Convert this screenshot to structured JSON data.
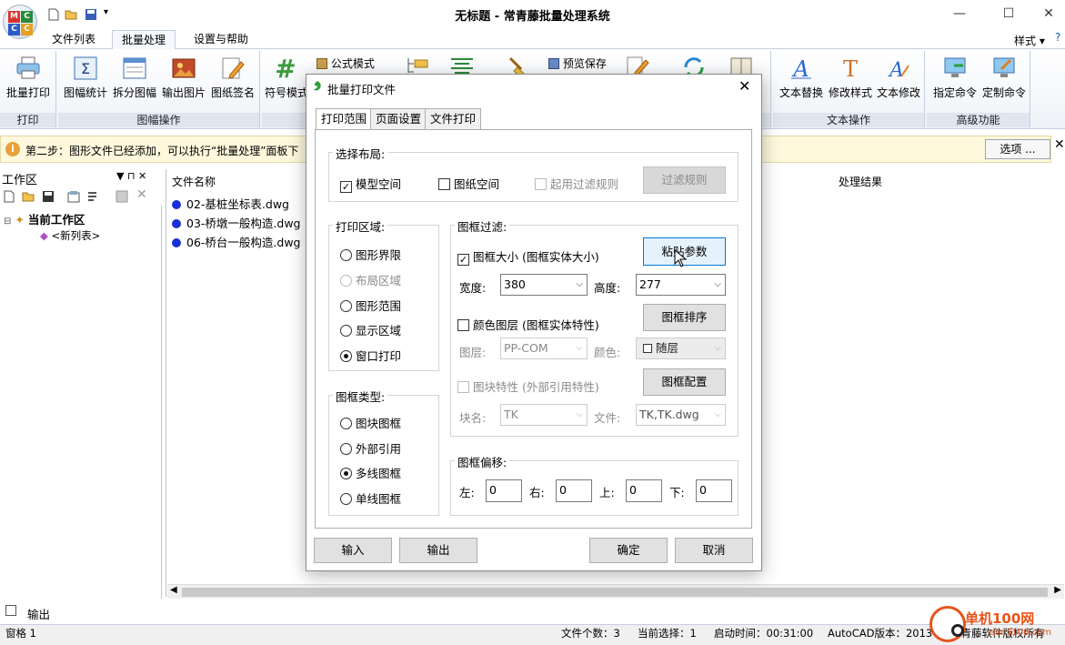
{
  "window": {
    "title": "无标题 - 常青藤批量处理系统",
    "minimize": "—",
    "maximize": "☐",
    "close": "✕"
  },
  "app_logo_letters": [
    "M",
    "C",
    "C",
    "C"
  ],
  "menu_tabs": [
    "文件列表",
    "批量处理",
    "设置与帮助"
  ],
  "style_menu": "样式",
  "ribbon": {
    "groups": {
      "print": "打印",
      "frame_ops": "图幅操作",
      "text_ops": "文本操作",
      "advanced": "高级功能"
    },
    "buttons": {
      "batch_print": "批量打印",
      "frame_stats": "图幅统计",
      "split_frame": "拆分图幅",
      "export_image": "输出图片",
      "sign_drawing": "图纸签名",
      "symbol_mode": "符号模式",
      "formula_mode": "公式模式",
      "preview_save": "预览保存",
      "text_replace": "文本替换",
      "modify_style": "修改样式",
      "text_modify": "文本修改",
      "assign_command": "指定命令",
      "custom_command": "定制命令"
    }
  },
  "info_bar": {
    "text": "第二步：图形文件已经添加，可以执行“批量处理”面板下",
    "options": "选项 ..."
  },
  "workspace": {
    "title": "工作区",
    "pin": "▼ ⊓ ✕",
    "tree_root": "当前工作区",
    "tree_child": "<新列表>"
  },
  "file_list": {
    "col_name": "文件名称",
    "col_result": "处理结果",
    "files": [
      "02-基桩坐标表.dwg",
      "03-桥墩一般构造.dwg",
      "06-桥台一般构造.dwg"
    ]
  },
  "bottom": {
    "output_tab": "输出",
    "pane": "窗格 1",
    "file_count": "文件个数：3",
    "current_selection": "当前选择：1",
    "start_time": "启动时间：00:31:00",
    "autocad_version": "AutoCAD版本：2013",
    "copyright": "常青藤软件版权所有"
  },
  "watermark": {
    "brand": "单机100网",
    "url": "danji100.com"
  },
  "dialog": {
    "title": "批量打印文件",
    "tabs": [
      "打印范围",
      "页面设置",
      "文件打印"
    ],
    "layout": {
      "legend": "选择布局:",
      "model_space": "模型空间",
      "paper_space": "图纸空间",
      "enable_filter": "起用过滤规则",
      "filter_rules": "过滤规则"
    },
    "print_area": {
      "legend": "打印区域:",
      "options": [
        "图形界限",
        "布局区域",
        "图形范围",
        "显示区域",
        "窗口打印"
      ]
    },
    "frame_type": {
      "legend": "图框类型:",
      "options": [
        "图块图框",
        "外部引用",
        "多线图框",
        "单线图框"
      ]
    },
    "frame_filter": {
      "legend": "图框过滤:",
      "frame_size": "图框大小 (图框实体大小)",
      "paste_params": "粘贴参数",
      "width_label": "宽度:",
      "width_value": "380",
      "height_label": "高度:",
      "height_value": "277",
      "color_layer": "颜色图层 (图框实体特性)",
      "frame_sort": "图框排序",
      "layer_label": "图层:",
      "layer_value": "PP-COM",
      "color_label": "颜色:",
      "color_value": "随层",
      "block_attr": "图块特性 (外部引用特性)",
      "frame_config": "图框配置",
      "block_name_label": "块名:",
      "block_name_value": "TK",
      "file_label": "文件:",
      "file_value": "TK,TK.dwg"
    },
    "frame_offset": {
      "legend": "图框偏移:",
      "left_label": "左:",
      "left_value": "0",
      "right_label": "右:",
      "right_value": "0",
      "top_label": "上:",
      "top_value": "0",
      "bottom_label": "下:",
      "bottom_value": "0"
    },
    "buttons": {
      "import": "输入",
      "export": "输出",
      "ok": "确定",
      "cancel": "取消"
    }
  }
}
